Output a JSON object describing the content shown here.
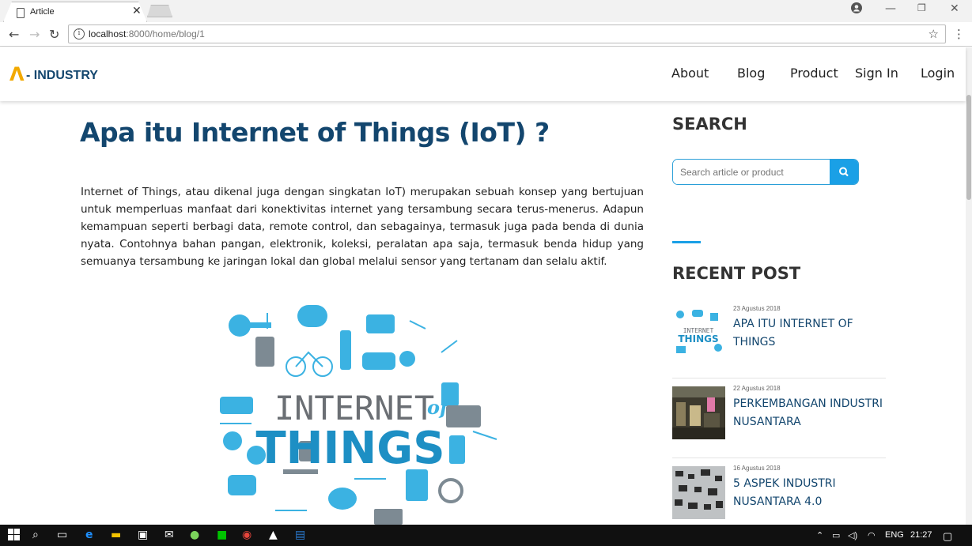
{
  "browser": {
    "tab_title": "Article",
    "url_host": "localhost",
    "url_path": ":8000/home/blog/1"
  },
  "site": {
    "logo_mark": "Λ",
    "logo_text": "- INDUSTRY",
    "nav": [
      {
        "label": "About"
      },
      {
        "label": "Blog"
      },
      {
        "label": "Product"
      },
      {
        "label": "Sign In"
      },
      {
        "label": "Login"
      }
    ]
  },
  "article": {
    "title": "Apa itu Internet of Things (IoT) ?",
    "body": "Internet of Things, atau dikenal juga dengan singkatan IoT) merupakan sebuah konsep yang bertujuan untuk memperluas manfaat dari konektivitas internet yang tersambung secara terus-menerus. Adapun kemampuan seperti berbagi data, remote control, dan sebagainya, termasuk juga pada benda di dunia nyata. Contohnya bahan pangan, elektronik, koleksi, peralatan apa saja, termasuk benda hidup yang semuanya tersambung ke jaringan lokal dan global melalui sensor yang tertanam dan selalu aktif.",
    "image_text_1": "INTERNET",
    "image_text_2": "of",
    "image_text_3": "THINGS"
  },
  "sidebar": {
    "search_heading": "SEARCH",
    "search_placeholder": "Search article or product",
    "recent_heading": "RECENT POST",
    "posts": [
      {
        "date": "23 Agustus 2018",
        "title": "APA ITU INTERNET OF THINGS",
        "thumb_text": "INTERNET THINGS"
      },
      {
        "date": "22 Agustus 2018",
        "title": "PERKEMBANGAN INDUSTRI NUSANTARA"
      },
      {
        "date": "16 Agustus 2018",
        "title": "5 ASPEK INDUSTRI NUSANTARA 4.0"
      }
    ]
  },
  "taskbar": {
    "lang": "ENG",
    "time": "21:27"
  },
  "colors": {
    "brand_dark": "#13466e",
    "accent_blue": "#1aa0e6",
    "logo_orange": "#f2a900"
  }
}
